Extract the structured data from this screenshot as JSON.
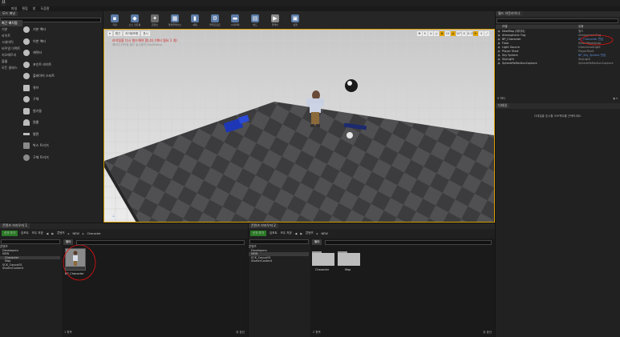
{
  "menu": [
    "파일",
    "편집",
    "창",
    "도움말"
  ],
  "modes": {
    "tab": "모드 패널",
    "categories": [
      "최근 배치됨",
      "기본",
      "라이트",
      "시네마틱",
      "비주얼 이펙트",
      "지오메트리",
      "볼륨",
      "모든 클래스"
    ],
    "items": [
      "기본 액터",
      "이번 액터",
      "캐릭터",
      "포인트 라이트",
      "플레이어 스타트",
      "큐브",
      "구체",
      "원기둥",
      "원뿔",
      "평면",
      "박스 트리거",
      "구체 트리거"
    ]
  },
  "toolbar": [
    "저장",
    "소스 컨트롤",
    "콘텐츠",
    "마켓플레이스",
    "세팅",
    "블루프린트",
    "시네마틱",
    "빌드",
    "플레이",
    "실행"
  ],
  "viewport": {
    "buttons": [
      "원근",
      "라이팅포함",
      "표시"
    ],
    "warning": "라이팅을 다시 빌드해야 합니다 (액터 필요 1 개)",
    "sub": "애디터 라이팅 빌드 일시중지 (BuiltData)",
    "right": [
      "10",
      "10°",
      "0.25",
      "4"
    ]
  },
  "outliner": {
    "tab": "월드 아웃라이너",
    "columns": [
      "라벨",
      "유형"
    ],
    "rows": [
      {
        "name": "NewMap (에디터)",
        "type": "월드"
      },
      {
        "name": "Atmospheric Fog",
        "type": "AtmosphericFog"
      },
      {
        "name": "BP_Character",
        "type": "BP_Character 편집"
      },
      {
        "name": "Floor",
        "type": "StaticMeshActor"
      },
      {
        "name": "Light Source",
        "type": "DirectionalLight"
      },
      {
        "name": "Player Start",
        "type": "PlayerStart"
      },
      {
        "name": "Sky Sphere",
        "type": "BP_Sky_Sphere 편집"
      },
      {
        "name": "SkyLight",
        "type": "SkyLight"
      },
      {
        "name": "SphereReflectionCapture",
        "type": "SphereReflectionCapture"
      }
    ],
    "count": "9 액터"
  },
  "details": {
    "tab": "디테일",
    "empty": "디테일을 표시할 오브젝트를 선택하세요."
  },
  "cb1": {
    "tab": "콘텐츠 브라우저 1",
    "add": "신규 추가",
    "import": "임포트",
    "save": "모두 저장",
    "path": [
      "콘텐츠",
      "NEW",
      "Character"
    ],
    "tree": [
      "콘텐츠",
      "Developers",
      "NEW",
      "Character",
      "Map",
      "SCK_Casual01",
      "StarterContent"
    ],
    "filter": "필터",
    "asset": "BP_Character",
    "status": "1 항목",
    "view": "뷰 옵션"
  },
  "cb2": {
    "tab": "콘텐츠 브라우저 2",
    "add": "신규 추가",
    "import": "임포트",
    "save": "모두 저장",
    "path": [
      "콘텐츠",
      "NEW"
    ],
    "tree": [
      "콘텐츠",
      "Developers",
      "NEW",
      "SCK_Casual01",
      "StarterContent"
    ],
    "filter": "필터",
    "folders": [
      "Character",
      "Map"
    ],
    "status": "2 항목",
    "view": "뷰 옵션"
  }
}
